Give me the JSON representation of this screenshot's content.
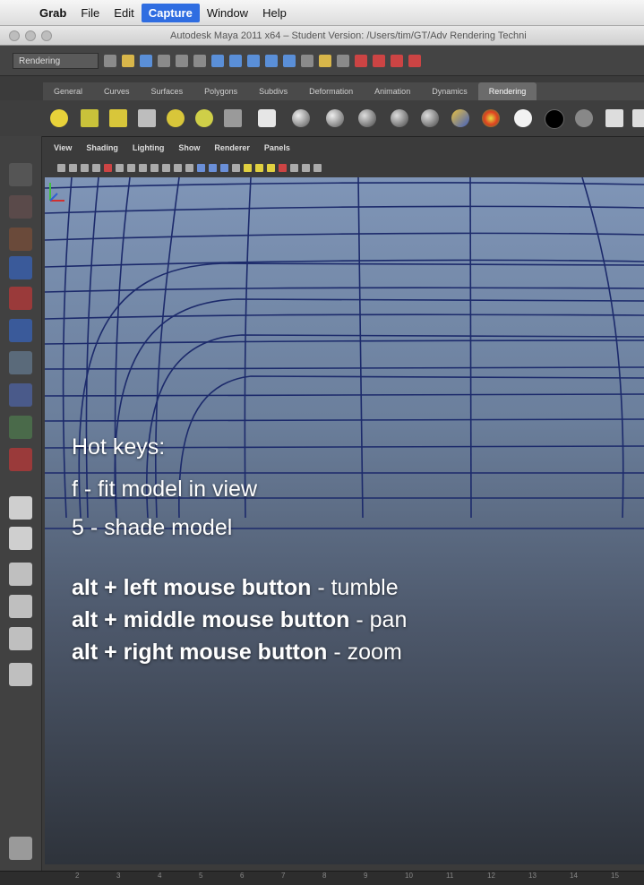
{
  "menubar": {
    "app": "Grab",
    "items": [
      "File",
      "Edit",
      "Capture",
      "Window",
      "Help"
    ],
    "active": "Capture"
  },
  "window": {
    "title": "Autodesk Maya 2011 x64 – Student Version: /Users/tim/GT/Adv Rendering Techni"
  },
  "status": {
    "mode": "Rendering"
  },
  "shelf_tabs": [
    "General",
    "Curves",
    "Surfaces",
    "Polygons",
    "Subdivs",
    "Deformation",
    "Animation",
    "Dynamics",
    "Rendering"
  ],
  "active_shelf_tab": "Rendering",
  "panel_menu": [
    "View",
    "Shading",
    "Lighting",
    "Show",
    "Renderer",
    "Panels"
  ],
  "hotkeys": {
    "title": "Hot keys:",
    "simple": [
      "f - fit model in view",
      "5 - shade model"
    ],
    "mouse": [
      {
        "combo": "alt + left mouse button",
        "action": " - tumble"
      },
      {
        "combo": "alt + middle mouse button",
        "action": " - pan"
      },
      {
        "combo": "alt + right mouse button",
        "action": " - zoom"
      }
    ]
  },
  "timeslider": {
    "ticks": [
      "2",
      "3",
      "4",
      "5",
      "6",
      "7",
      "8",
      "9",
      "10",
      "11",
      "12",
      "13",
      "14",
      "15"
    ]
  },
  "colors": {
    "menu_active": "#2f6de1",
    "wire": "#1c2a6b",
    "viewport_top": "#7f95b7"
  }
}
